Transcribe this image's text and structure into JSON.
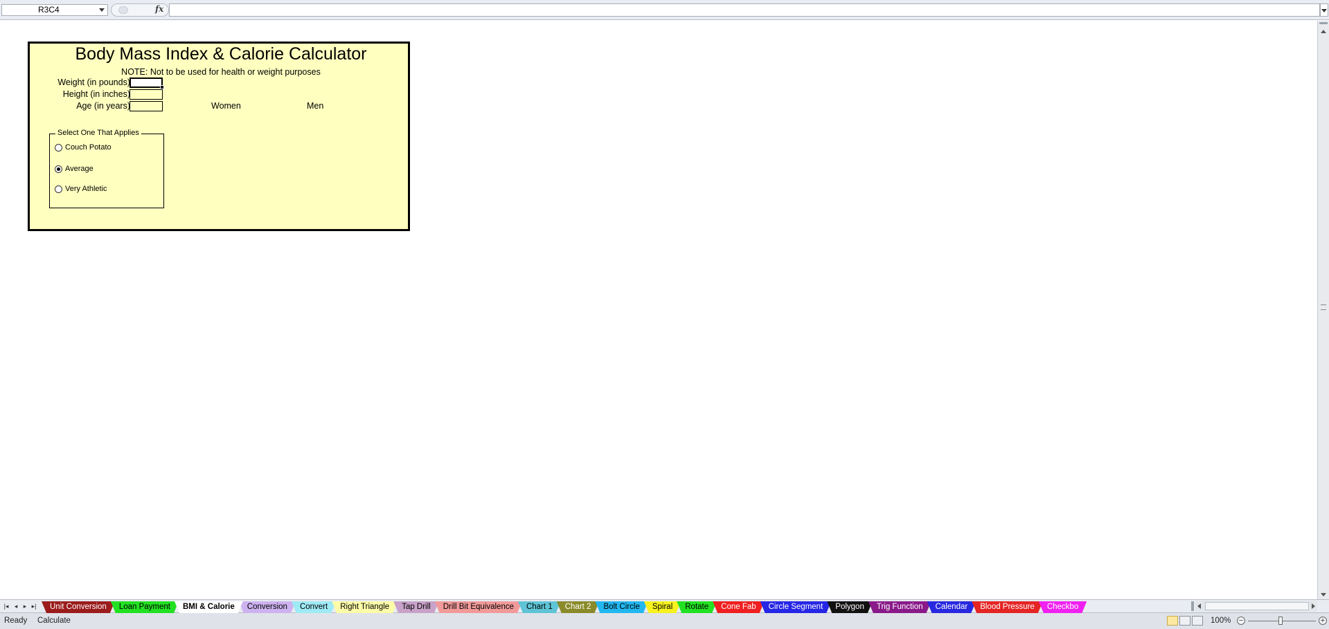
{
  "formula_bar": {
    "name_box": "R3C4",
    "fx_label": "fx",
    "formula_value": ""
  },
  "calculator": {
    "title": "Body Mass Index & Calorie Calculator",
    "note": "NOTE: Not to be used for health or weight purposes",
    "fields": [
      {
        "label": "Weight (in pounds)",
        "value": ""
      },
      {
        "label": "Height (in inches)",
        "value": ""
      },
      {
        "label": "Age (in years)",
        "value": ""
      }
    ],
    "columns": {
      "women": "Women",
      "men": "Men"
    },
    "activity_group": {
      "title": "Select One That Applies",
      "options": [
        {
          "label": "Couch Potato",
          "checked": false
        },
        {
          "label": "Average",
          "checked": true
        },
        {
          "label": "Very Athletic",
          "checked": false
        }
      ]
    }
  },
  "sheet_tabs": [
    {
      "label": "Unit Conversion",
      "color": "#9b1c1c",
      "text_color": "#ffffff",
      "active": false
    },
    {
      "label": "Loan Payment",
      "color": "#22e022",
      "text_color": "#000000",
      "active": false
    },
    {
      "label": "BMI & Calorie",
      "color": "#ffffff",
      "text_color": "#000000",
      "active": true
    },
    {
      "label": "Conversion",
      "color": "#cdb2f0",
      "text_color": "#000000",
      "active": false
    },
    {
      "label": "Convert",
      "color": "#9eeaf5",
      "text_color": "#000000",
      "active": false
    },
    {
      "label": "Right Triangle",
      "color": "#fdfca8",
      "text_color": "#000000",
      "active": false
    },
    {
      "label": "Tap Drill",
      "color": "#c8a2c8",
      "text_color": "#000000",
      "active": false
    },
    {
      "label": "Drill Bit Equivalence",
      "color": "#f29a9a",
      "text_color": "#000000",
      "active": false
    },
    {
      "label": "Chart 1",
      "color": "#5fc5d6",
      "text_color": "#000000",
      "active": false
    },
    {
      "label": "Chart 2",
      "color": "#8a8a2a",
      "text_color": "#ffffff",
      "active": false
    },
    {
      "label": "Bolt Circle",
      "color": "#22b7f0",
      "text_color": "#000000",
      "active": false
    },
    {
      "label": "Spiral",
      "color": "#f7f21e",
      "text_color": "#000000",
      "active": false
    },
    {
      "label": "Rotate",
      "color": "#22e022",
      "text_color": "#000000",
      "active": false
    },
    {
      "label": "Cone Fab",
      "color": "#f02020",
      "text_color": "#ffffff",
      "active": false
    },
    {
      "label": "Circle Segment",
      "color": "#2626e6",
      "text_color": "#ffffff",
      "active": false
    },
    {
      "label": "Polygon",
      "color": "#111111",
      "text_color": "#ffffff",
      "active": false
    },
    {
      "label": "Trig Function",
      "color": "#8a1a8a",
      "text_color": "#ffffff",
      "active": false
    },
    {
      "label": "Calendar",
      "color": "#2828e0",
      "text_color": "#ffffff",
      "active": false
    },
    {
      "label": "Blood Pressure",
      "color": "#e52424",
      "text_color": "#ffffff",
      "active": false
    },
    {
      "label": "Checkbo",
      "color": "#f020f0",
      "text_color": "#ffffff",
      "active": false
    }
  ],
  "status_bar": {
    "mode": "Ready",
    "calc": "Calculate",
    "zoom": "100%"
  }
}
